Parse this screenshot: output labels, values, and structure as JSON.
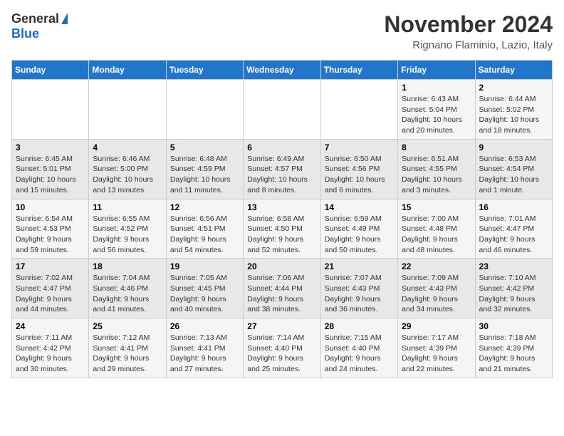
{
  "header": {
    "logo_general": "General",
    "logo_blue": "Blue",
    "month_title": "November 2024",
    "location": "Rignano Flaminio, Lazio, Italy"
  },
  "weekdays": [
    "Sunday",
    "Monday",
    "Tuesday",
    "Wednesday",
    "Thursday",
    "Friday",
    "Saturday"
  ],
  "weeks": [
    [
      {
        "day": "",
        "detail": ""
      },
      {
        "day": "",
        "detail": ""
      },
      {
        "day": "",
        "detail": ""
      },
      {
        "day": "",
        "detail": ""
      },
      {
        "day": "",
        "detail": ""
      },
      {
        "day": "1",
        "detail": "Sunrise: 6:43 AM\nSunset: 5:04 PM\nDaylight: 10 hours\nand 20 minutes."
      },
      {
        "day": "2",
        "detail": "Sunrise: 6:44 AM\nSunset: 5:02 PM\nDaylight: 10 hours\nand 18 minutes."
      }
    ],
    [
      {
        "day": "3",
        "detail": "Sunrise: 6:45 AM\nSunset: 5:01 PM\nDaylight: 10 hours\nand 15 minutes."
      },
      {
        "day": "4",
        "detail": "Sunrise: 6:46 AM\nSunset: 5:00 PM\nDaylight: 10 hours\nand 13 minutes."
      },
      {
        "day": "5",
        "detail": "Sunrise: 6:48 AM\nSunset: 4:59 PM\nDaylight: 10 hours\nand 11 minutes."
      },
      {
        "day": "6",
        "detail": "Sunrise: 6:49 AM\nSunset: 4:57 PM\nDaylight: 10 hours\nand 8 minutes."
      },
      {
        "day": "7",
        "detail": "Sunrise: 6:50 AM\nSunset: 4:56 PM\nDaylight: 10 hours\nand 6 minutes."
      },
      {
        "day": "8",
        "detail": "Sunrise: 6:51 AM\nSunset: 4:55 PM\nDaylight: 10 hours\nand 3 minutes."
      },
      {
        "day": "9",
        "detail": "Sunrise: 6:53 AM\nSunset: 4:54 PM\nDaylight: 10 hours\nand 1 minute."
      }
    ],
    [
      {
        "day": "10",
        "detail": "Sunrise: 6:54 AM\nSunset: 4:53 PM\nDaylight: 9 hours\nand 59 minutes."
      },
      {
        "day": "11",
        "detail": "Sunrise: 6:55 AM\nSunset: 4:52 PM\nDaylight: 9 hours\nand 56 minutes."
      },
      {
        "day": "12",
        "detail": "Sunrise: 6:56 AM\nSunset: 4:51 PM\nDaylight: 9 hours\nand 54 minutes."
      },
      {
        "day": "13",
        "detail": "Sunrise: 6:58 AM\nSunset: 4:50 PM\nDaylight: 9 hours\nand 52 minutes."
      },
      {
        "day": "14",
        "detail": "Sunrise: 6:59 AM\nSunset: 4:49 PM\nDaylight: 9 hours\nand 50 minutes."
      },
      {
        "day": "15",
        "detail": "Sunrise: 7:00 AM\nSunset: 4:48 PM\nDaylight: 9 hours\nand 48 minutes."
      },
      {
        "day": "16",
        "detail": "Sunrise: 7:01 AM\nSunset: 4:47 PM\nDaylight: 9 hours\nand 46 minutes."
      }
    ],
    [
      {
        "day": "17",
        "detail": "Sunrise: 7:02 AM\nSunset: 4:47 PM\nDaylight: 9 hours\nand 44 minutes."
      },
      {
        "day": "18",
        "detail": "Sunrise: 7:04 AM\nSunset: 4:46 PM\nDaylight: 9 hours\nand 41 minutes."
      },
      {
        "day": "19",
        "detail": "Sunrise: 7:05 AM\nSunset: 4:45 PM\nDaylight: 9 hours\nand 40 minutes."
      },
      {
        "day": "20",
        "detail": "Sunrise: 7:06 AM\nSunset: 4:44 PM\nDaylight: 9 hours\nand 38 minutes."
      },
      {
        "day": "21",
        "detail": "Sunrise: 7:07 AM\nSunset: 4:43 PM\nDaylight: 9 hours\nand 36 minutes."
      },
      {
        "day": "22",
        "detail": "Sunrise: 7:09 AM\nSunset: 4:43 PM\nDaylight: 9 hours\nand 34 minutes."
      },
      {
        "day": "23",
        "detail": "Sunrise: 7:10 AM\nSunset: 4:42 PM\nDaylight: 9 hours\nand 32 minutes."
      }
    ],
    [
      {
        "day": "24",
        "detail": "Sunrise: 7:11 AM\nSunset: 4:42 PM\nDaylight: 9 hours\nand 30 minutes."
      },
      {
        "day": "25",
        "detail": "Sunrise: 7:12 AM\nSunset: 4:41 PM\nDaylight: 9 hours\nand 29 minutes."
      },
      {
        "day": "26",
        "detail": "Sunrise: 7:13 AM\nSunset: 4:41 PM\nDaylight: 9 hours\nand 27 minutes."
      },
      {
        "day": "27",
        "detail": "Sunrise: 7:14 AM\nSunset: 4:40 PM\nDaylight: 9 hours\nand 25 minutes."
      },
      {
        "day": "28",
        "detail": "Sunrise: 7:15 AM\nSunset: 4:40 PM\nDaylight: 9 hours\nand 24 minutes."
      },
      {
        "day": "29",
        "detail": "Sunrise: 7:17 AM\nSunset: 4:39 PM\nDaylight: 9 hours\nand 22 minutes."
      },
      {
        "day": "30",
        "detail": "Sunrise: 7:18 AM\nSunset: 4:39 PM\nDaylight: 9 hours\nand 21 minutes."
      }
    ]
  ]
}
